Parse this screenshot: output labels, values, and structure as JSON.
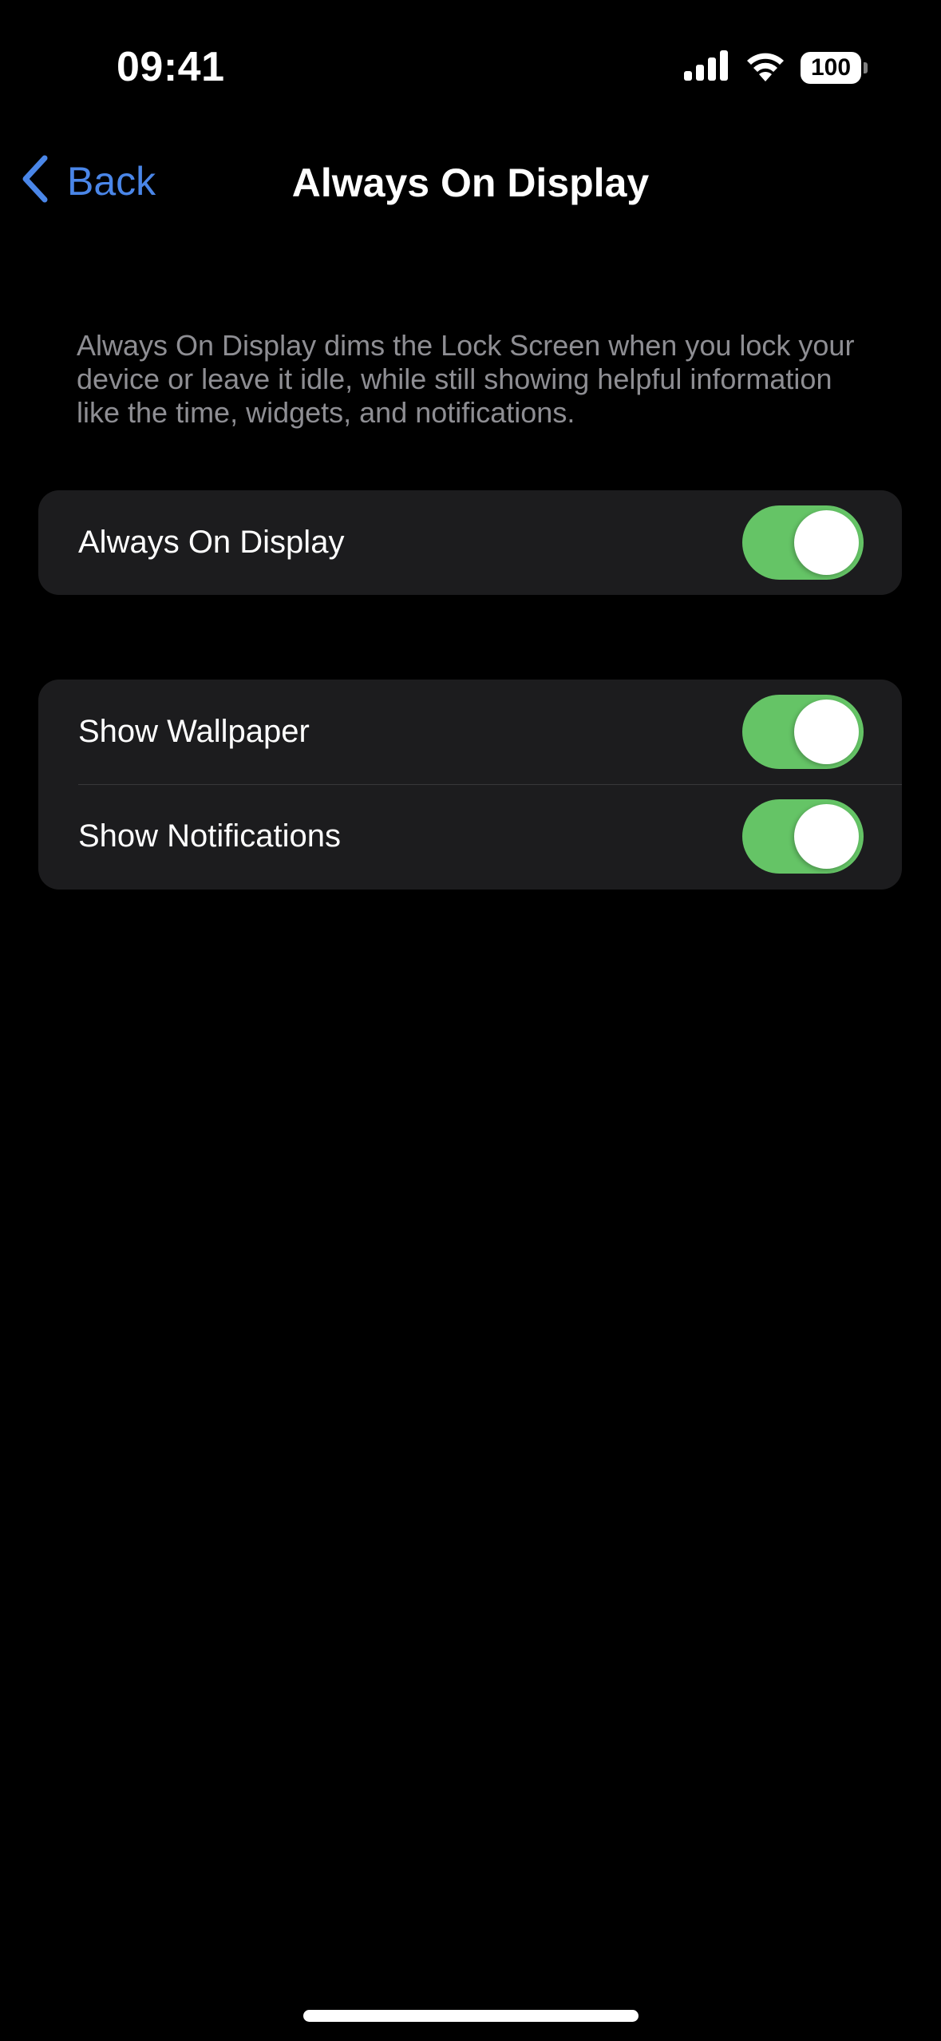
{
  "status_bar": {
    "time": "09:41",
    "signal_icon": "cellular-signal-icon",
    "wifi_icon": "wifi-icon",
    "battery_level": "100"
  },
  "nav": {
    "back_label": "Back",
    "back_icon": "chevron-left-icon",
    "title": "Always On Display"
  },
  "description": "Always On Display dims the Lock Screen when you lock your device or leave it idle, while still showing helpful information like the time, widgets, and notifications.",
  "sections": [
    {
      "rows": [
        {
          "label": "Always On Display",
          "toggle_on": true
        }
      ]
    },
    {
      "rows": [
        {
          "label": "Show Wallpaper",
          "toggle_on": true
        },
        {
          "label": "Show Notifications",
          "toggle_on": true
        }
      ]
    }
  ],
  "colors": {
    "accent_blue": "#4a86e8",
    "toggle_on_green": "#65c466",
    "card_background": "#1c1c1e",
    "secondary_text": "#8e8e93"
  }
}
